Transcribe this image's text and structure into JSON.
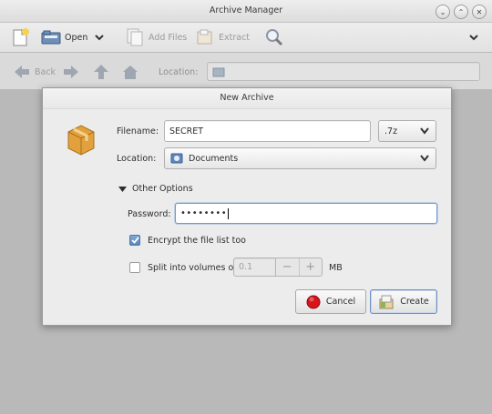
{
  "window": {
    "title": "Archive Manager",
    "buttons": [
      "minimize",
      "maximize",
      "close"
    ]
  },
  "toolbar": {
    "new_icon": "new-archive-icon",
    "open_label": "Open",
    "add_files_label": "Add Files",
    "extract_label": "Extract",
    "find_icon": "search-icon",
    "menu_icon": "chevron-down-icon"
  },
  "navbar": {
    "back_label": "Back",
    "location_label": "Location:",
    "location_value": ""
  },
  "dialog": {
    "title": "New Archive",
    "filename_label": "Filename:",
    "filename_value": "SECRET",
    "extension_value": ".7z",
    "location_label": "Location:",
    "location_value": "Documents",
    "other_options_label": "Other Options",
    "password_label": "Password:",
    "password_value": "••••••••",
    "encrypt_label": "Encrypt the file list too",
    "encrypt_checked": true,
    "split_label": "Split into volumes of",
    "split_checked": false,
    "split_value": "0.1",
    "split_unit": "MB",
    "minus_symbol": "−",
    "plus_symbol": "+",
    "cancel_label": "Cancel",
    "create_label": "Create"
  },
  "colors": {
    "focus_border": "#6f9bd1",
    "checkbox_checked": "#5a86bc",
    "cancel_icon": "#d7141a",
    "archive_icon": "#e8a640"
  }
}
